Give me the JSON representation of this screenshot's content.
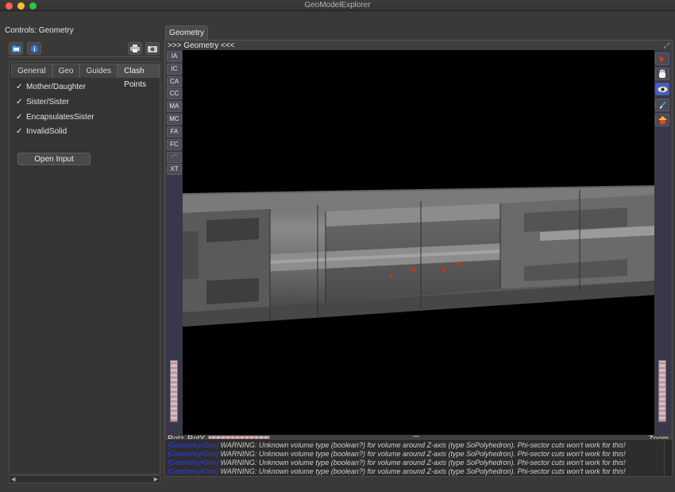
{
  "window": {
    "title": "GeoModelExplorer",
    "colors": {
      "close": "#fe5f57",
      "minimize": "#febc2e",
      "maximize": "#28c840"
    }
  },
  "dock": {
    "title": "Controls: Geometry",
    "toolbar_icons": [
      "open-file-icon",
      "info-icon",
      "print-icon",
      "snapshot-icon"
    ],
    "tabs": [
      {
        "label": "General"
      },
      {
        "label": "Geo"
      },
      {
        "label": "Guides"
      },
      {
        "label": "Clash Points",
        "active": true
      }
    ],
    "checks": [
      {
        "label": "Mother/Daughter",
        "checked": true
      },
      {
        "label": "Sister/Sister",
        "checked": true
      },
      {
        "label": "EncapsulatesSister",
        "checked": true
      },
      {
        "label": "InvalidSolid",
        "checked": true
      }
    ],
    "open_input_label": "Open Input"
  },
  "viewer": {
    "tab_label": "Geometry",
    "header": ">>> Geometry <<<",
    "left_buttons": [
      "IA",
      "IC",
      "CA",
      "CC",
      "MA",
      "MC",
      "FA",
      "FC",
      "",
      "XT"
    ],
    "right_icons": [
      "select-arrow-icon",
      "hand-icon",
      "eye-icon",
      "brush-icon",
      "home-icon"
    ],
    "rotz_label": "Rotz",
    "roty_label": "RotY",
    "zoom_label": "Zoom",
    "clash_point_color": "#e02a1e"
  },
  "log": {
    "lines": [
      {
        "tag": "[Geometry/Geo]",
        "text": " WARNING: Unknown volume type (boolean?) for volume around Z-axis (type SoPolyhedron). Phi-sector cuts won't work for this!"
      },
      {
        "tag": "[Geometry/Geo]",
        "text": " WARNING: Unknown volume type (boolean?) for volume around Z-axis (type SoPolyhedron). Phi-sector cuts won't work for this!"
      },
      {
        "tag": "[Geometry/Geo]",
        "text": " WARNING: Unknown volume type (boolean?) for volume around Z-axis (type SoPolyhedron). Phi-sector cuts won't work for this!"
      },
      {
        "tag": "[Geometry/Geo]",
        "text": " WARNING: Unknown volume type (boolean?) for volume around Z-axis (type SoPolyhedron). Phi-sector cuts won't work for this!"
      }
    ]
  }
}
